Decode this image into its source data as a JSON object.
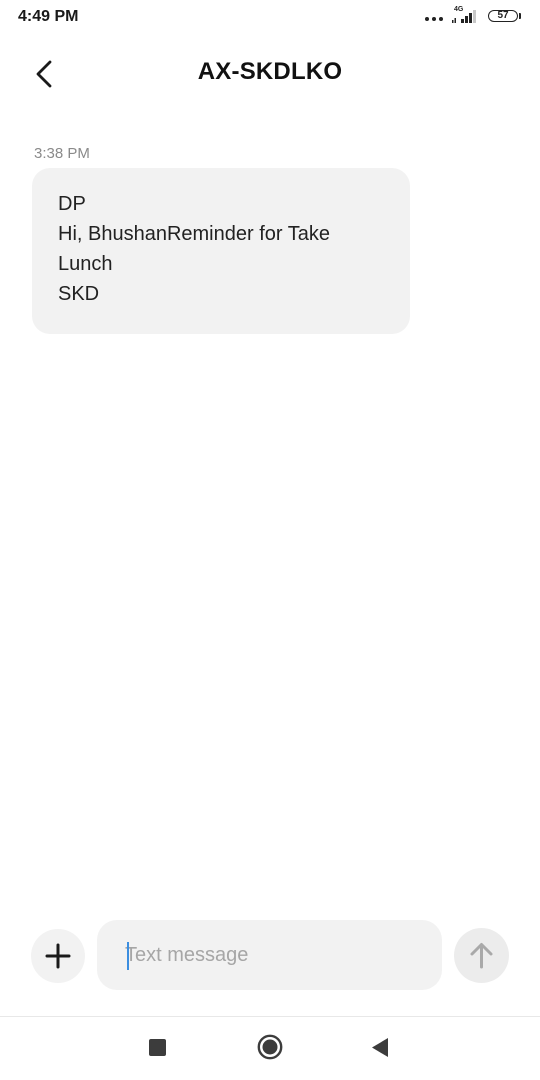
{
  "status_bar": {
    "time": "4:49 PM",
    "network_label": "4G",
    "battery_level": "57",
    "icons": [
      "more-dots-icon",
      "signal-icon",
      "battery-icon"
    ]
  },
  "header": {
    "title": "AX-SKDLKO",
    "back_icon": "chevron-left-icon"
  },
  "conversation": {
    "messages": [
      {
        "time": "3:38 PM",
        "lines": [
          "DP",
          "Hi, BhushanReminder for Take",
          "Lunch",
          "SKD"
        ]
      }
    ]
  },
  "composer": {
    "placeholder": "Text message",
    "value": "",
    "add_icon": "plus-icon",
    "send_icon": "arrow-up-icon"
  },
  "nav_bar": {
    "icons": [
      "recents-square-icon",
      "home-circle-icon",
      "back-triangle-icon"
    ]
  },
  "colors": {
    "bubble_bg": "#f2f2f2",
    "caret": "#3b8ee0",
    "placeholder": "#a6a6a6",
    "timestamp": "#8a8a8a"
  }
}
